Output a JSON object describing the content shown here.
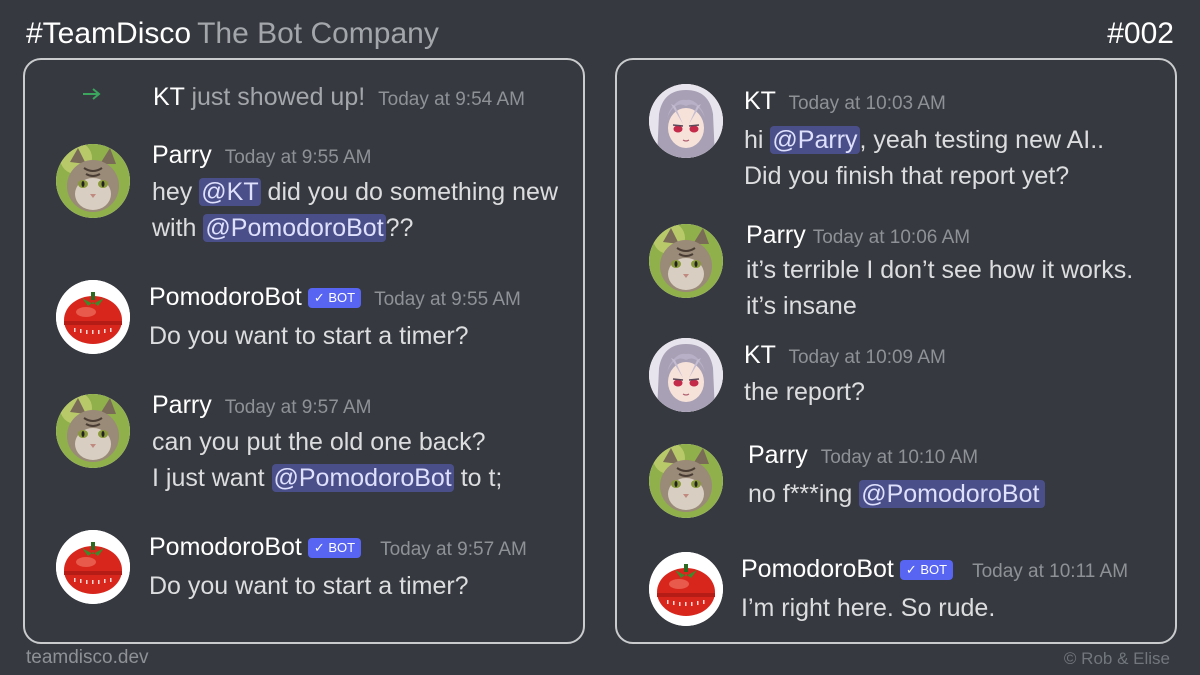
{
  "header": {
    "brand": "#TeamDisco",
    "subtitle": "The Bot Company",
    "episode": "#002"
  },
  "footer": {
    "site": "teamdisco.dev",
    "credit": "©  Rob & Elise"
  },
  "bot_tag": "✓ BOT",
  "left_panel": {
    "join": {
      "user": "KT",
      "text": "just showed up!",
      "time": "Today at 9:54 AM"
    },
    "messages": [
      {
        "author": "Parry",
        "time": "Today at 9:55 AM",
        "l1a": "hey ",
        "l1m": "@KT",
        "l1b": " did you do something new",
        "l2a": "with ",
        "l2m": "@PomodoroBot",
        "l2b": "??"
      },
      {
        "author": "PomodoroBot",
        "time": "Today at 9:55 AM",
        "l1": "Do you want to start a timer?"
      },
      {
        "author": "Parry",
        "time": "Today at 9:57 AM",
        "l1": "can you put the old one back?",
        "l2a": "I just want ",
        "l2m": "@PomodoroBot",
        "l2b": " to t;"
      },
      {
        "author": "PomodoroBot",
        "time": "Today at 9:57 AM",
        "l1": "Do you want to start a timer?"
      }
    ]
  },
  "right_panel": {
    "messages": [
      {
        "author": "KT",
        "time": "Today at 10:03 AM",
        "l1a": "hi ",
        "l1m": "@Parry",
        "l1b": ", yeah testing new AI..",
        "l2": "Did you finish that report yet?"
      },
      {
        "author": "Parry",
        "time": "Today at 10:06 AM",
        "l1": "it’s terrible  I don’t see how it works.",
        "l2": "it’s insane"
      },
      {
        "author": "KT",
        "time": "Today at 10:09 AM",
        "l1": "the report?"
      },
      {
        "author": "Parry",
        "time": "Today at 10:10 AM",
        "l1a": "no f***ing ",
        "l1m": "@PomodoroBot "
      },
      {
        "author": "PomodoroBot",
        "time": "Today at 10:11 AM",
        "l1": "I’m right here.  So rude."
      }
    ]
  },
  "colors": {
    "background": "#36393f",
    "mention_bg": "#4a4f8a",
    "bot_tag": "#5865f2",
    "join_arrow": "#3ba55d"
  },
  "icons": {
    "join": "arrow-right-icon",
    "bot_check": "check-icon"
  }
}
